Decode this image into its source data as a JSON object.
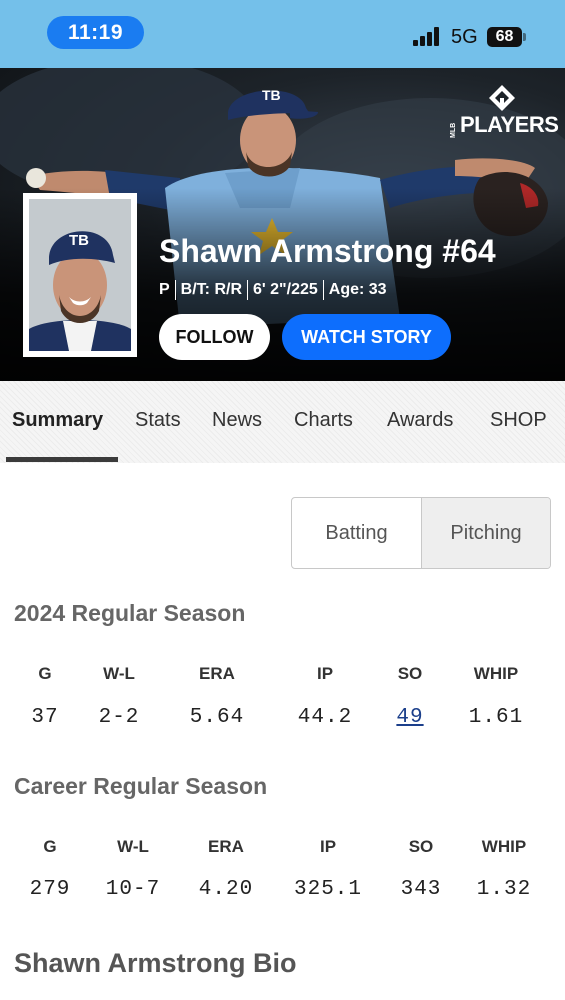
{
  "status_bar": {
    "time": "11:19",
    "network": "5G",
    "battery": "68"
  },
  "hero": {
    "logo_text": "PLAYERS",
    "logo_side": "MLB",
    "player_name": "Shawn Armstrong #64",
    "meta": [
      "P",
      "B/T: R/R",
      "6' 2\"/225",
      "Age: 33"
    ],
    "follow_label": "FOLLOW",
    "watch_label": "WATCH STORY"
  },
  "tabs": [
    {
      "label": "Summary",
      "active": true
    },
    {
      "label": "Stats"
    },
    {
      "label": "News"
    },
    {
      "label": "Charts"
    },
    {
      "label": "Awards"
    },
    {
      "label": "SHOP"
    }
  ],
  "toggle": {
    "batting": "Batting",
    "pitching": "Pitching",
    "selected": "Pitching"
  },
  "season": {
    "title": "2024 Regular Season",
    "headers": [
      "G",
      "W-L",
      "ERA",
      "IP",
      "SO",
      "WHIP"
    ],
    "values": [
      "37",
      "2-2",
      "5.64",
      "44.2",
      "49",
      "1.61"
    ]
  },
  "career": {
    "title": "Career Regular Season",
    "headers": [
      "G",
      "W-L",
      "ERA",
      "IP",
      "SO",
      "WHIP"
    ],
    "values": [
      "279",
      "10-7",
      "4.20",
      "325.1",
      "343",
      "1.32"
    ]
  },
  "bio_title": "Shawn Armstrong Bio",
  "colors": {
    "status_bar": "#74c0ea",
    "time_pill": "#1a7cf1",
    "watch_button": "#0d6efd",
    "link": "#1b3f8b"
  }
}
